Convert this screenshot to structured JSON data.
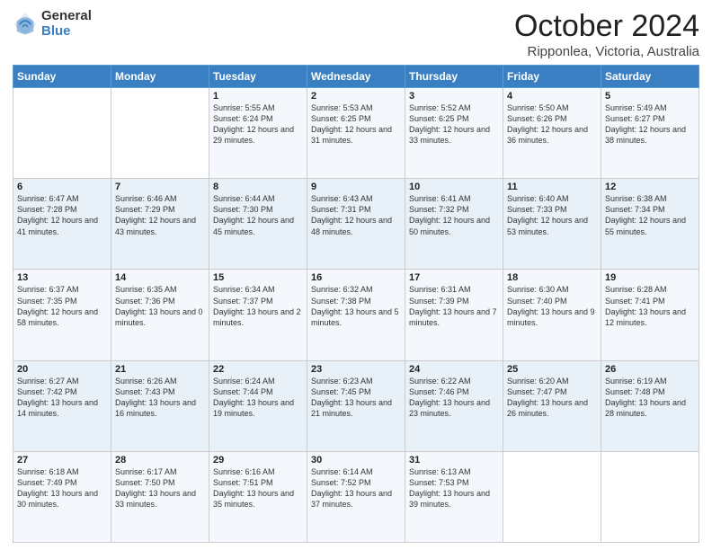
{
  "logo": {
    "general": "General",
    "blue": "Blue"
  },
  "title": {
    "month": "October 2024",
    "location": "Ripponlea, Victoria, Australia"
  },
  "weekdays": [
    "Sunday",
    "Monday",
    "Tuesday",
    "Wednesday",
    "Thursday",
    "Friday",
    "Saturday"
  ],
  "weeks": [
    [
      {
        "day": "",
        "details": ""
      },
      {
        "day": "",
        "details": ""
      },
      {
        "day": "1",
        "details": "Sunrise: 5:55 AM\nSunset: 6:24 PM\nDaylight: 12 hours and 29 minutes."
      },
      {
        "day": "2",
        "details": "Sunrise: 5:53 AM\nSunset: 6:25 PM\nDaylight: 12 hours and 31 minutes."
      },
      {
        "day": "3",
        "details": "Sunrise: 5:52 AM\nSunset: 6:25 PM\nDaylight: 12 hours and 33 minutes."
      },
      {
        "day": "4",
        "details": "Sunrise: 5:50 AM\nSunset: 6:26 PM\nDaylight: 12 hours and 36 minutes."
      },
      {
        "day": "5",
        "details": "Sunrise: 5:49 AM\nSunset: 6:27 PM\nDaylight: 12 hours and 38 minutes."
      }
    ],
    [
      {
        "day": "6",
        "details": "Sunrise: 6:47 AM\nSunset: 7:28 PM\nDaylight: 12 hours and 41 minutes."
      },
      {
        "day": "7",
        "details": "Sunrise: 6:46 AM\nSunset: 7:29 PM\nDaylight: 12 hours and 43 minutes."
      },
      {
        "day": "8",
        "details": "Sunrise: 6:44 AM\nSunset: 7:30 PM\nDaylight: 12 hours and 45 minutes."
      },
      {
        "day": "9",
        "details": "Sunrise: 6:43 AM\nSunset: 7:31 PM\nDaylight: 12 hours and 48 minutes."
      },
      {
        "day": "10",
        "details": "Sunrise: 6:41 AM\nSunset: 7:32 PM\nDaylight: 12 hours and 50 minutes."
      },
      {
        "day": "11",
        "details": "Sunrise: 6:40 AM\nSunset: 7:33 PM\nDaylight: 12 hours and 53 minutes."
      },
      {
        "day": "12",
        "details": "Sunrise: 6:38 AM\nSunset: 7:34 PM\nDaylight: 12 hours and 55 minutes."
      }
    ],
    [
      {
        "day": "13",
        "details": "Sunrise: 6:37 AM\nSunset: 7:35 PM\nDaylight: 12 hours and 58 minutes."
      },
      {
        "day": "14",
        "details": "Sunrise: 6:35 AM\nSunset: 7:36 PM\nDaylight: 13 hours and 0 minutes."
      },
      {
        "day": "15",
        "details": "Sunrise: 6:34 AM\nSunset: 7:37 PM\nDaylight: 13 hours and 2 minutes."
      },
      {
        "day": "16",
        "details": "Sunrise: 6:32 AM\nSunset: 7:38 PM\nDaylight: 13 hours and 5 minutes."
      },
      {
        "day": "17",
        "details": "Sunrise: 6:31 AM\nSunset: 7:39 PM\nDaylight: 13 hours and 7 minutes."
      },
      {
        "day": "18",
        "details": "Sunrise: 6:30 AM\nSunset: 7:40 PM\nDaylight: 13 hours and 9 minutes."
      },
      {
        "day": "19",
        "details": "Sunrise: 6:28 AM\nSunset: 7:41 PM\nDaylight: 13 hours and 12 minutes."
      }
    ],
    [
      {
        "day": "20",
        "details": "Sunrise: 6:27 AM\nSunset: 7:42 PM\nDaylight: 13 hours and 14 minutes."
      },
      {
        "day": "21",
        "details": "Sunrise: 6:26 AM\nSunset: 7:43 PM\nDaylight: 13 hours and 16 minutes."
      },
      {
        "day": "22",
        "details": "Sunrise: 6:24 AM\nSunset: 7:44 PM\nDaylight: 13 hours and 19 minutes."
      },
      {
        "day": "23",
        "details": "Sunrise: 6:23 AM\nSunset: 7:45 PM\nDaylight: 13 hours and 21 minutes."
      },
      {
        "day": "24",
        "details": "Sunrise: 6:22 AM\nSunset: 7:46 PM\nDaylight: 13 hours and 23 minutes."
      },
      {
        "day": "25",
        "details": "Sunrise: 6:20 AM\nSunset: 7:47 PM\nDaylight: 13 hours and 26 minutes."
      },
      {
        "day": "26",
        "details": "Sunrise: 6:19 AM\nSunset: 7:48 PM\nDaylight: 13 hours and 28 minutes."
      }
    ],
    [
      {
        "day": "27",
        "details": "Sunrise: 6:18 AM\nSunset: 7:49 PM\nDaylight: 13 hours and 30 minutes."
      },
      {
        "day": "28",
        "details": "Sunrise: 6:17 AM\nSunset: 7:50 PM\nDaylight: 13 hours and 33 minutes."
      },
      {
        "day": "29",
        "details": "Sunrise: 6:16 AM\nSunset: 7:51 PM\nDaylight: 13 hours and 35 minutes."
      },
      {
        "day": "30",
        "details": "Sunrise: 6:14 AM\nSunset: 7:52 PM\nDaylight: 13 hours and 37 minutes."
      },
      {
        "day": "31",
        "details": "Sunrise: 6:13 AM\nSunset: 7:53 PM\nDaylight: 13 hours and 39 minutes."
      },
      {
        "day": "",
        "details": ""
      },
      {
        "day": "",
        "details": ""
      }
    ]
  ]
}
